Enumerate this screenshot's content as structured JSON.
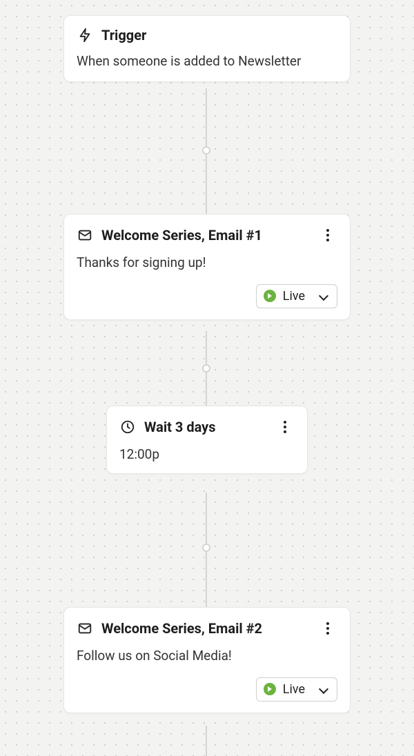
{
  "trigger": {
    "title": "Trigger",
    "description": "When someone is added to Newsletter"
  },
  "email1": {
    "title": "Welcome Series, Email #1",
    "description": "Thanks for signing up!",
    "status_label": "Live"
  },
  "wait": {
    "title": "Wait 3 days",
    "time": "12:00p"
  },
  "email2": {
    "title": "Welcome Series, Email #2",
    "description": "Follow us on Social Media!",
    "status_label": "Live"
  }
}
